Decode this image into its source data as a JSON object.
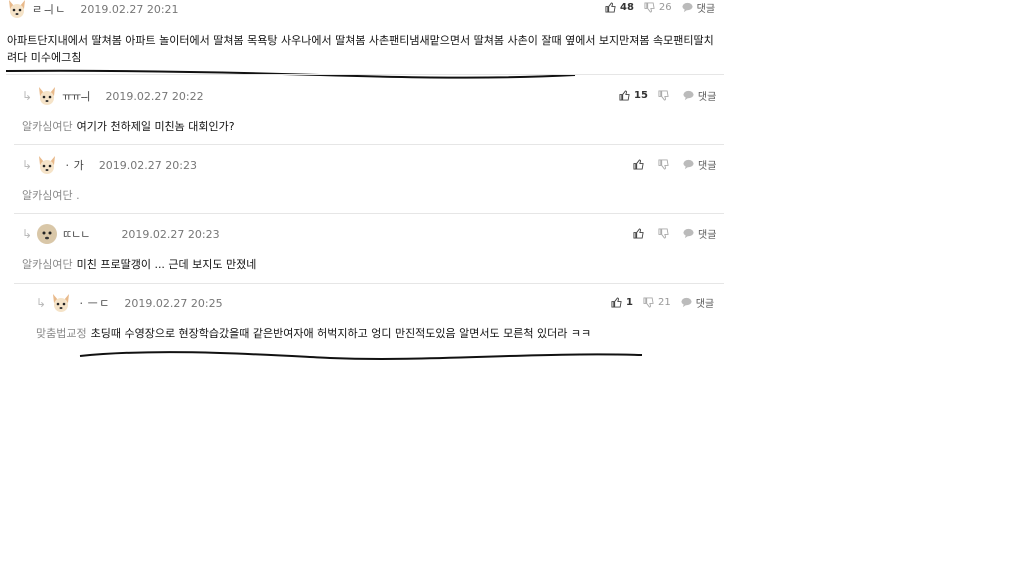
{
  "comments": [
    {
      "nick": "ㄹ ㅢ ㄴ",
      "date": "2019.02.27 20:21",
      "up": "48",
      "down": "26",
      "reply_label": "댓글",
      "tag": "",
      "text": "아파트단지내에서 딸쳐봄 아파트 놀이터에서 딸쳐봄 목욕탕 사우나에서 딸쳐봄 사촌팬티냄새맡으면서 딸쳐봄 사촌이 잘때 옆에서 보지만져봄 속모팬티딸치려다 미수에그침"
    },
    {
      "nick": "ㅠㅠㅢ",
      "date": "2019.02.27 20:22",
      "up": "15",
      "down": "",
      "reply_label": "댓글",
      "tag": "알카심여단",
      "text": "여기가 천하제일 미친놈 대회인가?"
    },
    {
      "nick": "ㆍ 가",
      "date": "2019.02.27 20:23",
      "up": "",
      "down": "",
      "reply_label": "댓글",
      "tag": "알카심여단 .",
      "text": ""
    },
    {
      "nick": "ㄸㄴㄴ",
      "date": "2019.02.27 20:23",
      "up": "",
      "down": "",
      "reply_label": "댓글",
      "tag": "알카심여단",
      "text": "미친 프로딸갱이 ... 근데 보지도 만졌네"
    },
    {
      "nick": "ㆍ ㅡ ㄷ",
      "date": "2019.02.27 20:25",
      "up": "1",
      "down": "21",
      "reply_label": "댓글",
      "tag": "맞춤법교정",
      "text": "초딩때 수영장으로 현장학습갔을때 같은반여자애 허벅지하고 엉디 만진적도있음 알면서도 모른척 있더라 ㅋㅋ"
    }
  ],
  "colors": {
    "accent": "#111111",
    "muted": "#888888",
    "line": "#e6e6e6"
  },
  "icons": {
    "thumbs_up": "thumbs-up-icon",
    "thumbs_down": "thumbs-down-icon",
    "speech": "speech-bubble-icon",
    "reply": "reply-arrow-icon",
    "avatar": "dog-avatar-icon"
  }
}
